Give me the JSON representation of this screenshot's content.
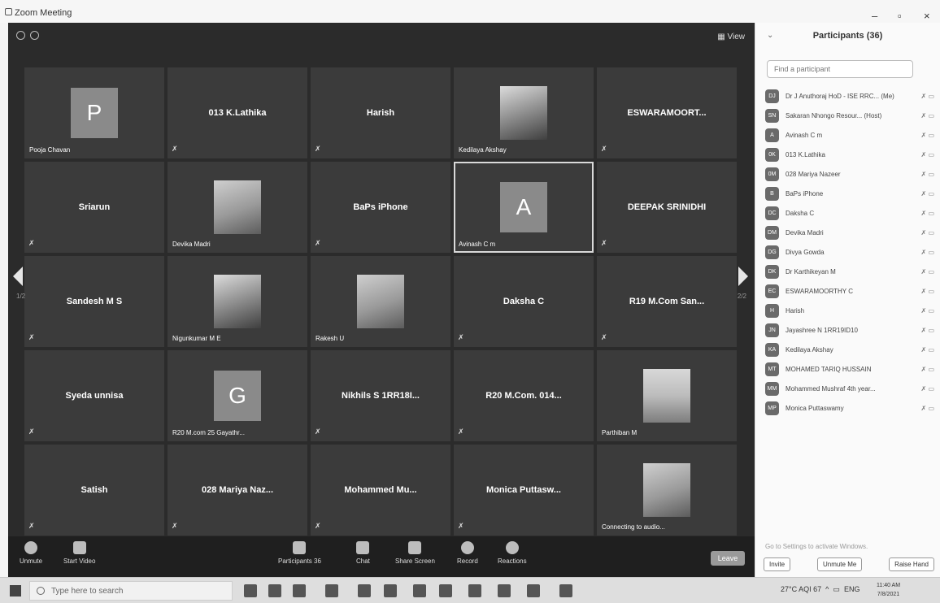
{
  "window": {
    "title": "Zoom Meeting"
  },
  "meeting": {
    "view_label": "View",
    "page_left": "1/2",
    "page_right": "2/2",
    "tiles": [
      {
        "kind": "avatar",
        "letter": "P",
        "caption": "Pooja Chavan"
      },
      {
        "kind": "name",
        "name": "013 K.Lathika"
      },
      {
        "kind": "name",
        "name": "Harish"
      },
      {
        "kind": "photo",
        "caption": "Kedilaya Akshay"
      },
      {
        "kind": "name",
        "name": "ESWARAMOORT..."
      },
      {
        "kind": "name",
        "name": "Sriarun"
      },
      {
        "kind": "photo",
        "caption": "Devika Madri"
      },
      {
        "kind": "name",
        "name": "BaPs iPhone"
      },
      {
        "kind": "avatar",
        "letter": "A",
        "caption": "Avinash C m",
        "highlight": true
      },
      {
        "kind": "name",
        "name": "DEEPAK SRINIDHI"
      },
      {
        "kind": "name",
        "name": "Sandesh M S"
      },
      {
        "kind": "photo",
        "caption": "Nigunkumar M E"
      },
      {
        "kind": "photo",
        "caption": "Rakesh U"
      },
      {
        "kind": "name",
        "name": "Daksha C"
      },
      {
        "kind": "name",
        "name": "R19 M.Com San..."
      },
      {
        "kind": "name",
        "name": "Syeda unnisa"
      },
      {
        "kind": "avatar",
        "letter": "G",
        "caption": "R20 M.com 25 Gayathr..."
      },
      {
        "kind": "name",
        "name": "Nikhils S 1RR18I..."
      },
      {
        "kind": "name",
        "name": "R20 M.Com. 014..."
      },
      {
        "kind": "photo",
        "caption": "Parthiban M"
      },
      {
        "kind": "name",
        "name": "Satish"
      },
      {
        "kind": "name",
        "name": "028 Mariya Naz..."
      },
      {
        "kind": "name",
        "name": "Mohammed Mu..."
      },
      {
        "kind": "name",
        "name": "Monica Puttasw..."
      },
      {
        "kind": "photo",
        "caption": "Connecting to audio..."
      }
    ]
  },
  "toolbar": {
    "unmute": "Unmute",
    "start_video": "Start Video",
    "participants": "Participants",
    "participants_count": "36",
    "chat": "Chat",
    "share_screen": "Share Screen",
    "record": "Record",
    "reactions": "Reactions",
    "leave": "Leave"
  },
  "panel": {
    "title": "Participants (36)",
    "search_placeholder": "Find a participant",
    "participants": [
      {
        "initials": "DJ",
        "name": "Dr J Anuthoraj HoD - ISE RRC... (Me)"
      },
      {
        "initials": "SN",
        "name": "Sakaran Nhongo Resour... (Host)"
      },
      {
        "initials": "A",
        "name": "Avinash C m"
      },
      {
        "initials": "0K",
        "name": "013 K.Lathika"
      },
      {
        "initials": "0M",
        "name": "028 Mariya Nazeer"
      },
      {
        "initials": "B",
        "name": "BaPs iPhone"
      },
      {
        "initials": "DC",
        "name": "Daksha C"
      },
      {
        "initials": "DM",
        "name": "Devika Madri"
      },
      {
        "initials": "DG",
        "name": "Divya Gowda"
      },
      {
        "initials": "DK",
        "name": "Dr Karthikeyan M"
      },
      {
        "initials": "EC",
        "name": "ESWARAMOORTHY C"
      },
      {
        "initials": "H",
        "name": "Harish"
      },
      {
        "initials": "JN",
        "name": "Jayashree N 1RR19ID10"
      },
      {
        "initials": "KA",
        "name": "Kedilaya Akshay"
      },
      {
        "initials": "MT",
        "name": "MOHAMED TARIQ HUSSAIN"
      },
      {
        "initials": "MM",
        "name": "Mohammed Mushraf 4th year..."
      },
      {
        "initials": "MP",
        "name": "Monica Puttaswamy"
      }
    ],
    "watermark": "Go to Settings to activate Windows.",
    "invite": "Invite",
    "unmute_me": "Unmute Me",
    "raise_hand": "Raise Hand"
  },
  "taskbar": {
    "search_placeholder": "Type here to search",
    "weather": "27°C AQI 67",
    "lang": "ENG",
    "time": "11:40 AM",
    "date": "7/8/2021"
  }
}
